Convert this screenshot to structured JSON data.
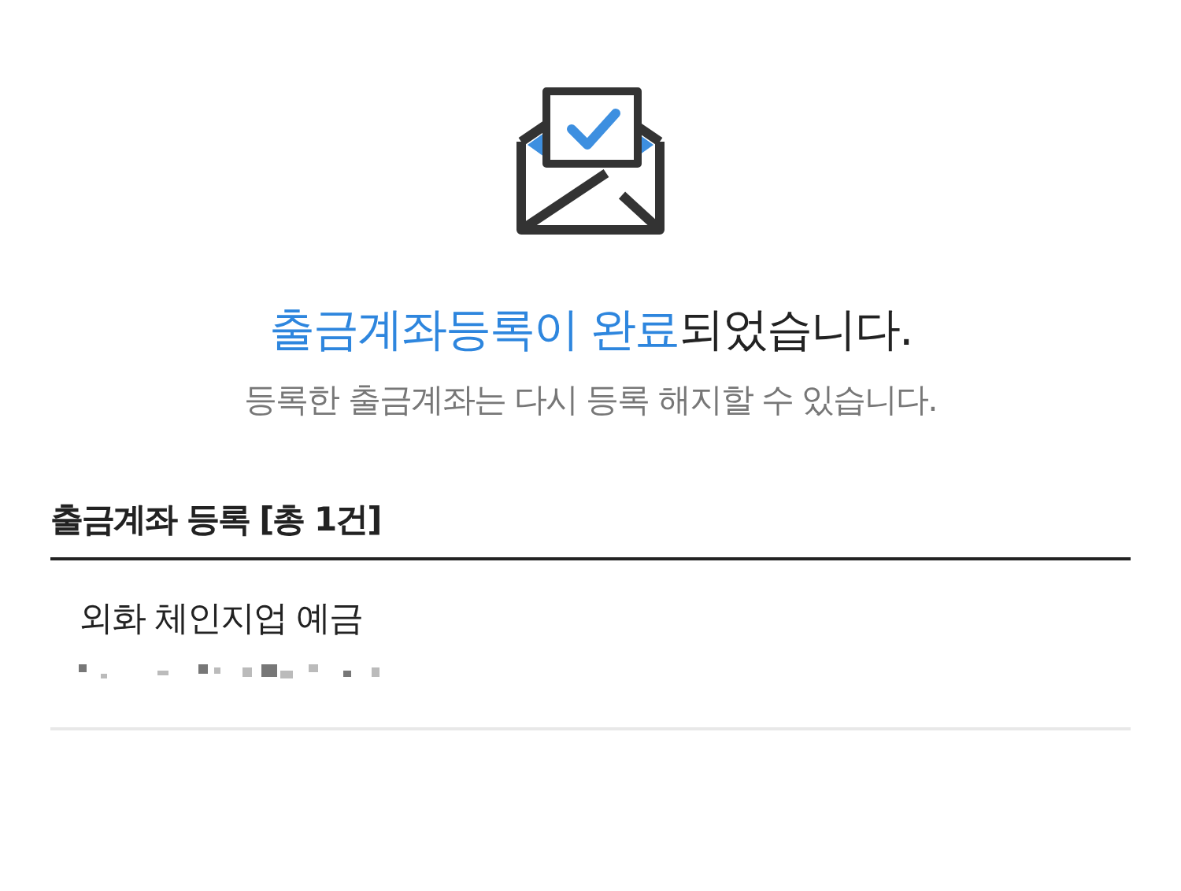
{
  "message": {
    "title": "**출금계좌등록이 완료**되었습니다.",
    "subtitle": "등록한 출금계좌는 다시 등록 해지할 수 있습니다."
  },
  "section": {
    "heading": "출금계좌 등록 [총 1건]",
    "accounts": [
      {
        "name": "외화 체인지업 예금"
      }
    ]
  }
}
